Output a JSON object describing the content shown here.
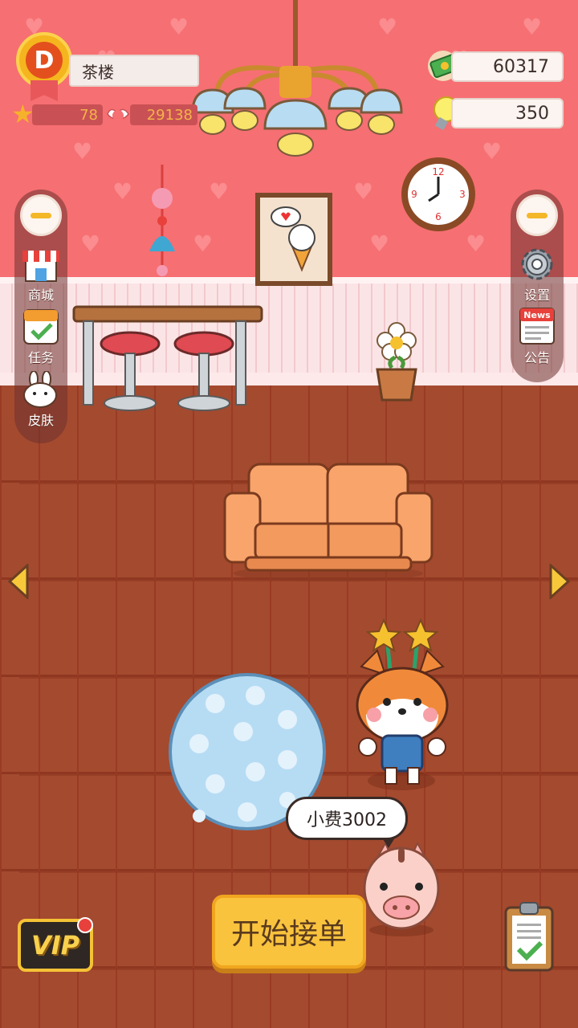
{
  "player": {
    "level_letter": "D",
    "shop_name": "茶楼",
    "stars": "78",
    "fans": "29138"
  },
  "currency": {
    "money": "60317",
    "ideas": "350"
  },
  "left_menu": [
    {
      "label": "商城",
      "icon": "shop-icon"
    },
    {
      "label": "任务",
      "icon": "task-icon"
    },
    {
      "label": "皮肤",
      "icon": "skin-icon"
    }
  ],
  "right_menu": [
    {
      "label": "设置",
      "icon": "gear-icon"
    },
    {
      "label": "公告",
      "icon": "news-icon"
    }
  ],
  "news_icon_text": "News",
  "clock": {
    "numbers": [
      "12",
      "3",
      "6",
      "9"
    ]
  },
  "tip_bubble": "小费3002",
  "start_button": "开始接单",
  "vip_label": "VIP",
  "colors": {
    "wall": "#f66f72",
    "floor": "#a84f33",
    "accent": "#f9c33d"
  }
}
